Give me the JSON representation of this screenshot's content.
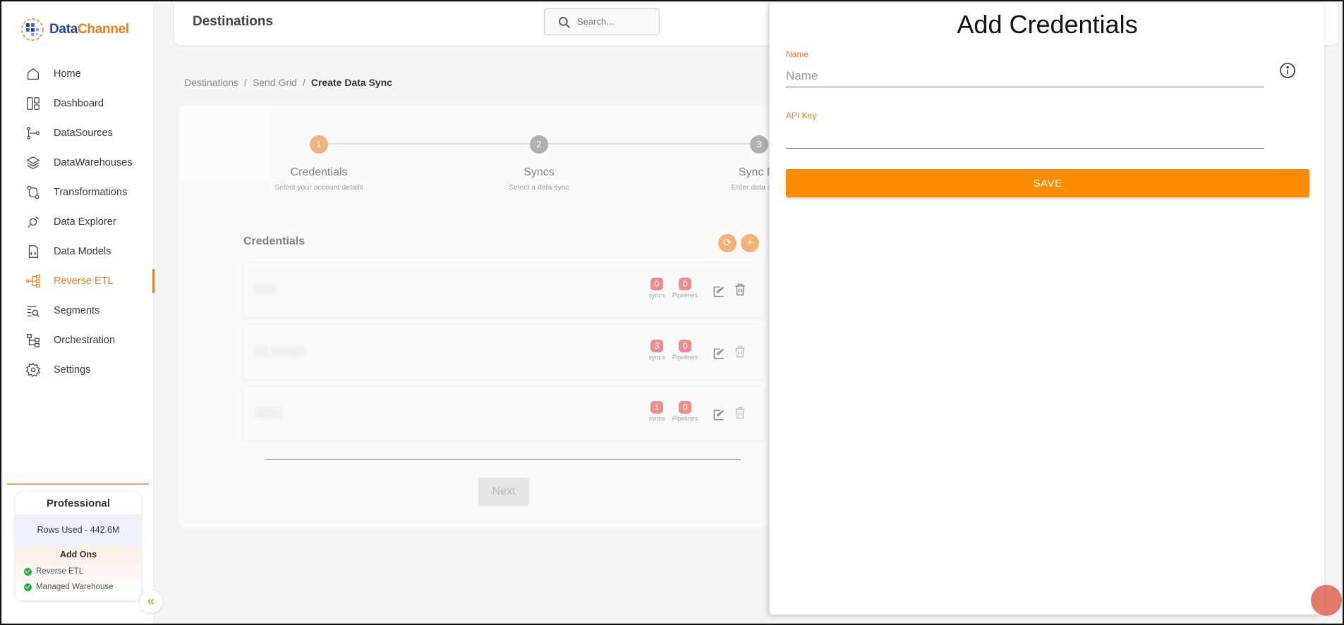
{
  "app": {
    "logo_part1": "Data",
    "logo_part2": "Channel"
  },
  "sidebar": {
    "items": [
      {
        "label": "Home",
        "icon": "home-icon"
      },
      {
        "label": "Dashboard",
        "icon": "dashboard-icon"
      },
      {
        "label": "DataSources",
        "icon": "datasources-icon"
      },
      {
        "label": "DataWarehouses",
        "icon": "layers-icon"
      },
      {
        "label": "Transformations",
        "icon": "transformations-icon"
      },
      {
        "label": "Data Explorer",
        "icon": "explorer-icon"
      },
      {
        "label": "Data Models",
        "icon": "data-models-icon"
      },
      {
        "label": "Reverse ETL",
        "icon": "reverse-etl-icon",
        "active": true
      },
      {
        "label": "Segments",
        "icon": "segments-icon"
      },
      {
        "label": "Orchestration",
        "icon": "orchestration-icon"
      },
      {
        "label": "Settings",
        "icon": "gear-icon"
      }
    ],
    "plan": {
      "title": "Professional",
      "rows_used": "Rows Used - 442.6M",
      "addons_title": "Add Ons",
      "addons": [
        "Reverse ETL",
        "Managed Warehouse"
      ]
    },
    "collapse_label": "«"
  },
  "topbar": {
    "title": "Destinations",
    "search_placeholder": "Search..."
  },
  "breadcrumb": {
    "items": [
      "Destinations",
      "Send Grid",
      "Create Data Sync"
    ],
    "separator": "/"
  },
  "stepper": {
    "steps": [
      {
        "number": "1",
        "label": "Credentials",
        "sub": "Select your account details"
      },
      {
        "number": "2",
        "label": "Syncs",
        "sub": "Select a data sync"
      },
      {
        "number": "3",
        "label": "Sync De",
        "sub": "Enter data sync c"
      }
    ]
  },
  "credentials": {
    "heading": "Credentials",
    "refresh_label": "⟳",
    "add_label": "+",
    "rows": [
      {
        "name": "▒▒▒",
        "syncs": "0",
        "pipelines": "0"
      },
      {
        "name": "▒▒ ▒▒▒▒▒",
        "syncs": "3",
        "pipelines": "0"
      },
      {
        "name": "▒▒▒▒",
        "syncs": "1",
        "pipelines": "0"
      }
    ],
    "syncs_label": "syncs",
    "pipelines_label": "Pipelines",
    "next_label": "Next"
  },
  "panel": {
    "title": "Add Credentials",
    "name_label": "Name",
    "name_placeholder": "Name",
    "name_value": "",
    "api_key_label": "API Key",
    "api_key_value": "",
    "save_label": "SAVE"
  },
  "colors": {
    "accent": "#f07d1a",
    "save": "#fb8c00",
    "badge": "#e23b3b"
  }
}
